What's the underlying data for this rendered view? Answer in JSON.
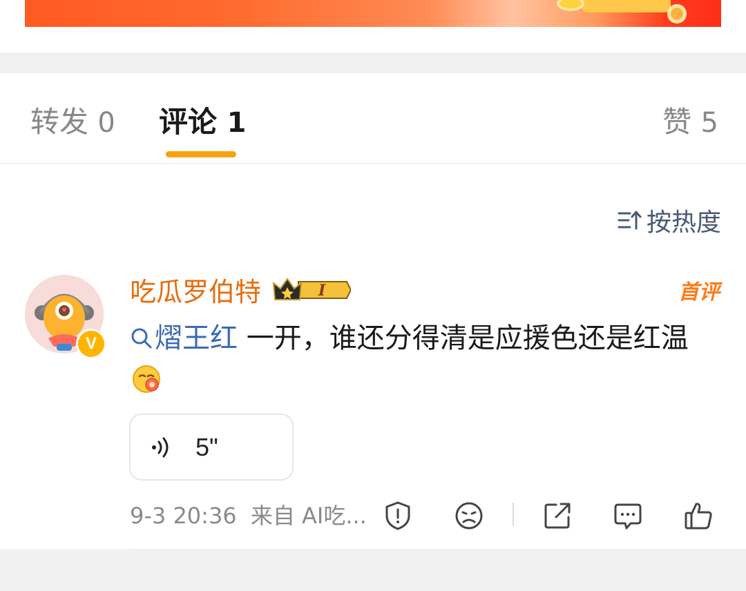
{
  "tabs": {
    "repost": {
      "label": "转发",
      "count": "0"
    },
    "comment": {
      "label": "评论",
      "count": "1"
    },
    "like": {
      "label": "赞",
      "count": "5"
    }
  },
  "sort": {
    "label": "按热度",
    "icon": "sort-icon"
  },
  "comment": {
    "username": "吃瓜罗伯特",
    "level_badge": "I",
    "first_comment_badge": "首评",
    "topic": "熠王红",
    "text": " 一开，谁还分得清是应援色还是红温",
    "voice_duration": "5\"",
    "timestamp": "9-3 20:36",
    "source": "来自 AI吃...",
    "verified_badge": "V"
  },
  "colors": {
    "username": "#e86b0a",
    "link": "#3a6ab4",
    "tab_underline": "#f6a10f",
    "first_badge": "#ff7a1a"
  }
}
